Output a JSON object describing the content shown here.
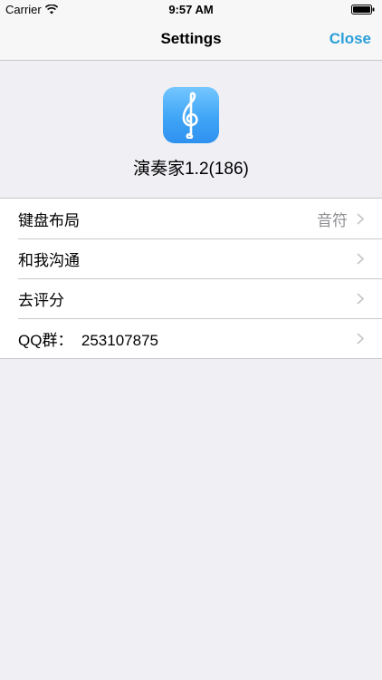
{
  "status_bar": {
    "carrier": "Carrier",
    "time": "9:57 AM"
  },
  "nav": {
    "title": "Settings",
    "close_label": "Close"
  },
  "app": {
    "version_text": "演奏家1.2(186)"
  },
  "rows": [
    {
      "label": "键盘布局",
      "detail": "音符"
    },
    {
      "label": "和我沟通",
      "detail": ""
    },
    {
      "label": "去评分",
      "detail": ""
    },
    {
      "label": "QQ群：  253107875",
      "detail": ""
    }
  ],
  "colors": {
    "accent": "#2b9fda",
    "background": "#efeff4",
    "separator": "#c8c7cc",
    "detail_text": "#8e8e93",
    "icon_gradient_top": "#74c7ff",
    "icon_gradient_bottom": "#2f91ef"
  },
  "icons": {
    "status_wifi": "wifi-icon",
    "status_battery": "battery-icon",
    "app_icon_glyph": "treble-clef-icon",
    "row_disclosure": "chevron-right-icon"
  }
}
